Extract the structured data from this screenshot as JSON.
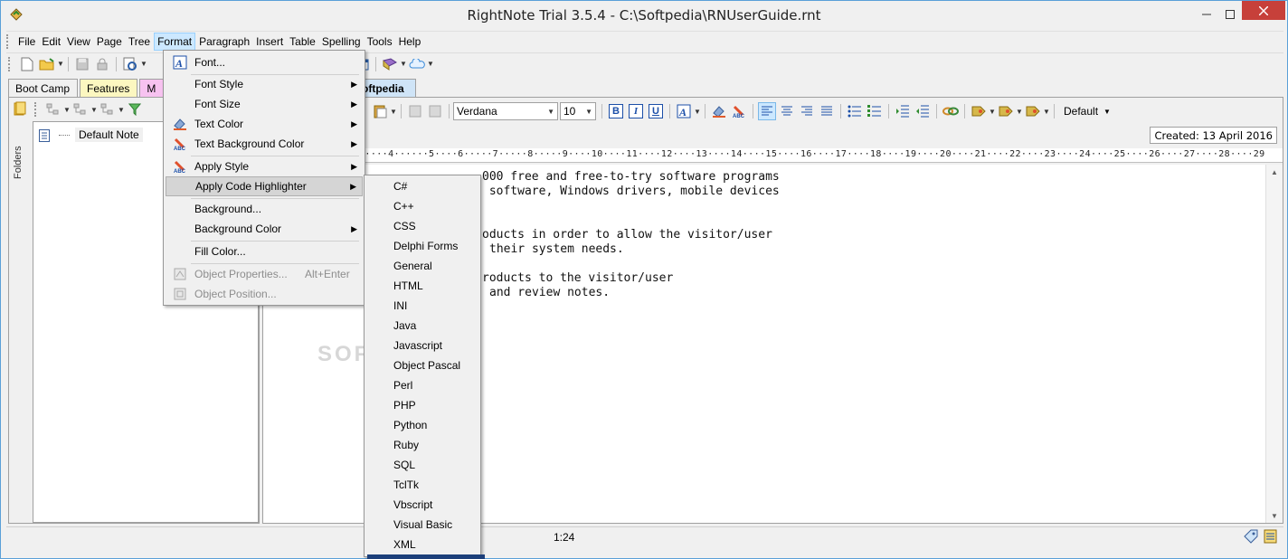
{
  "window": {
    "title": "RightNote Trial 3.5.4 - C:\\Softpedia\\RNUserGuide.rnt",
    "close_label": "✕",
    "minimize_label": "—",
    "maximize_label": "□"
  },
  "menubar": {
    "items": [
      "File",
      "Edit",
      "View",
      "Page",
      "Tree",
      "Format",
      "Paragraph",
      "Insert",
      "Table",
      "Spelling",
      "Tools",
      "Help"
    ],
    "active": "Format"
  },
  "left_tabs": [
    "Boot Camp",
    "Features",
    "M"
  ],
  "folders_label": "Folders",
  "tree": {
    "items": [
      {
        "label": "Default Note"
      }
    ]
  },
  "right_tab": "oftpedia",
  "format_toolbar": {
    "font": "Verdana",
    "size": "10",
    "bold": "B",
    "italic": "I",
    "underline": "U",
    "style": "Default"
  },
  "created_label": "Created: 13 April 2016",
  "ruler_text": "3····4······5····6·····7·····8·····9····10····11····12····13····14····15····16····17····18····19····20····21····22····23····24····25····26····27····28····29",
  "document": {
    "lines": [
      "000 free and free-to-try software programs",
      " software, Windows drivers, mobile devices",
      "",
      "",
      "oducts in order to allow the visitor/user",
      "their system needs.",
      "",
      "",
      "roducts to the visitor/user",
      "and review notes."
    ],
    "watermark": "SOFTPEDIA"
  },
  "status": {
    "position": "1:24"
  },
  "format_menu": {
    "items": [
      {
        "label": "Font...",
        "icon": "font-icon"
      },
      {
        "label": "Font Style",
        "submenu": true
      },
      {
        "label": "Font Size",
        "submenu": true
      },
      {
        "label": "Text Color",
        "icon": "text-color-icon",
        "submenu": true
      },
      {
        "label": "Text Background Color",
        "icon": "text-bg-color-icon",
        "submenu": true
      },
      {
        "label": "Apply Style",
        "icon": "apply-style-icon",
        "submenu": true
      },
      {
        "label": "Apply Code Highlighter",
        "submenu": true,
        "highlighted": true
      },
      {
        "label": "Background..."
      },
      {
        "label": "Background Color",
        "submenu": true
      },
      {
        "label": "Fill Color..."
      },
      {
        "label": "Object Properties...",
        "shortcut": "Alt+Enter",
        "disabled": true
      },
      {
        "label": "Object Position...",
        "disabled": true
      }
    ]
  },
  "code_highlighter_menu": {
    "items": [
      "C#",
      "C++",
      "CSS",
      "Delphi Forms",
      "General",
      "HTML",
      "INI",
      "Java",
      "Javascript",
      "Object Pascal",
      "Perl",
      "PHP",
      "Python",
      "Ruby",
      "SQL",
      "TclTk",
      "Vbscript",
      "Visual Basic",
      "XML"
    ]
  }
}
